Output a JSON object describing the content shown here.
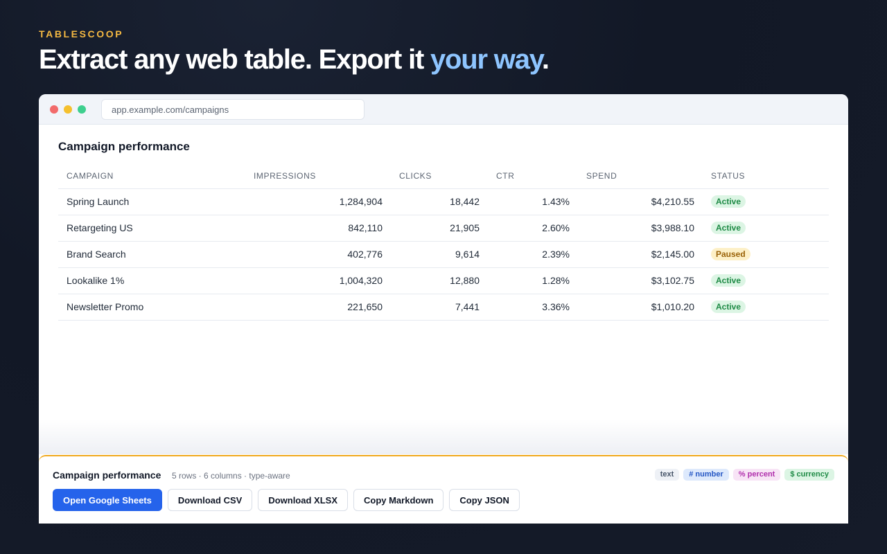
{
  "brand": "TABLESCOOP",
  "headline": {
    "prefix": "Extract any web table. Export it ",
    "accent": "your way",
    "suffix": "."
  },
  "browser": {
    "url": "app.example.com/campaigns"
  },
  "table": {
    "title": "Campaign performance",
    "columns": [
      "CAMPAIGN",
      "IMPRESSIONS",
      "CLICKS",
      "CTR",
      "SPEND",
      "STATUS"
    ],
    "rows": [
      {
        "campaign": "Spring Launch",
        "impressions": "1,284,904",
        "clicks": "18,442",
        "ctr": "1.43%",
        "spend": "$4,210.55",
        "status": "Active"
      },
      {
        "campaign": "Retargeting US",
        "impressions": "842,110",
        "clicks": "21,905",
        "ctr": "2.60%",
        "spend": "$3,988.10",
        "status": "Active"
      },
      {
        "campaign": "Brand Search",
        "impressions": "402,776",
        "clicks": "9,614",
        "ctr": "2.39%",
        "spend": "$2,145.00",
        "status": "Paused"
      },
      {
        "campaign": "Lookalike 1%",
        "impressions": "1,004,320",
        "clicks": "12,880",
        "ctr": "1.28%",
        "spend": "$3,102.75",
        "status": "Active"
      },
      {
        "campaign": "Newsletter Promo",
        "impressions": "221,650",
        "clicks": "7,441",
        "ctr": "3.36%",
        "spend": "$1,010.20",
        "status": "Active"
      }
    ]
  },
  "panel": {
    "title": "Campaign performance",
    "meta": "5 rows · 6 columns · type-aware",
    "chips": [
      "text",
      "# number",
      "% percent",
      "$ currency"
    ],
    "buttons": {
      "open_sheets": "Open Google Sheets",
      "download_csv": "Download CSV",
      "download_xlsx": "Download XLSX",
      "copy_markdown": "Copy Markdown",
      "copy_json": "Copy JSON"
    }
  },
  "colors": {
    "brand": "#f5b942",
    "accent": "#8ec5ff",
    "primary_button": "#2563eb",
    "panel_border": "#f0a81c",
    "status_active": "#1e8a45",
    "status_paused": "#9a6208"
  }
}
